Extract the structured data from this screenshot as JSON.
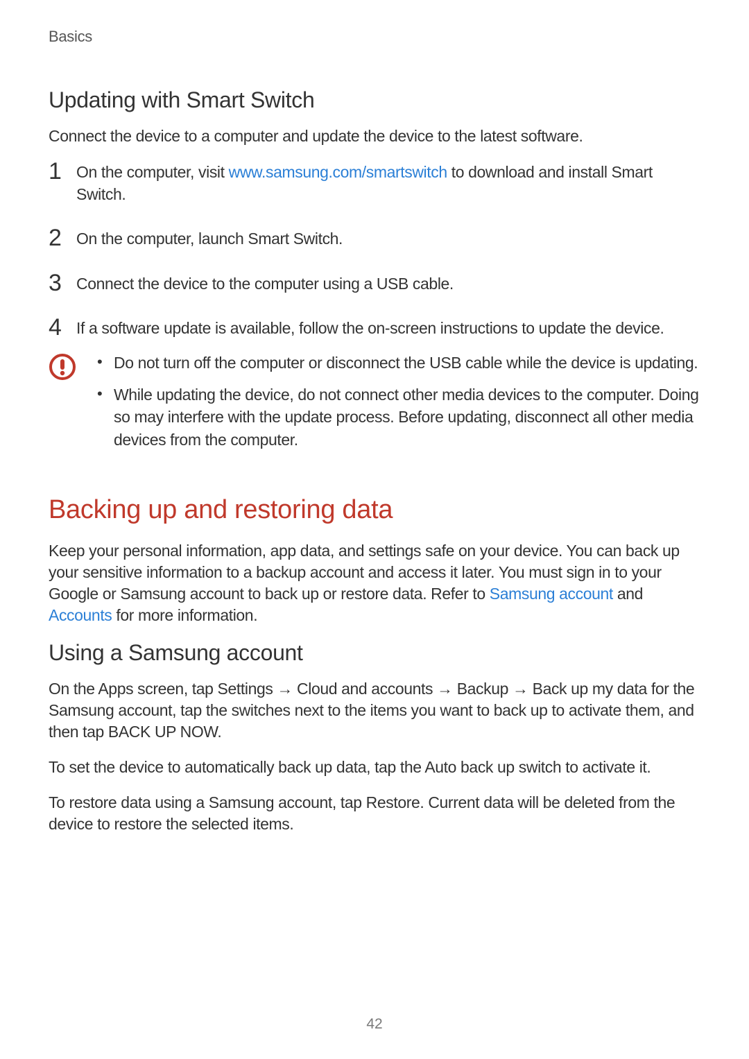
{
  "breadcrumb": "Basics",
  "section1": {
    "heading": "Updating with Smart Switch",
    "intro": "Connect the device to a computer and update the device to the latest software.",
    "steps": {
      "s1_pre": "On the computer, visit ",
      "s1_link": "www.samsung.com/smartswitch",
      "s1_post": " to download and install Smart Switch.",
      "s2": "On the computer, launch Smart Switch.",
      "s3": "Connect the device to the computer using a USB cable.",
      "s4": "If a software update is available, follow the on-screen instructions to update the device."
    },
    "caution": {
      "c1": "Do not turn off the computer or disconnect the USB cable while the device is updating.",
      "c2": "While updating the device, do not connect other media devices to the computer. Doing so may interfere with the update process. Before updating, disconnect all other media devices from the computer."
    }
  },
  "section2": {
    "heading": "Backing up and restoring data",
    "intro_pre": "Keep your personal information, app data, and settings safe on your device. You can back up your sensitive information to a backup account and access it later. You must sign in to your Google or Samsung account to back up or restore data. Refer to ",
    "intro_link1": "Samsung account",
    "intro_mid": " and ",
    "intro_link2": "Accounts",
    "intro_post": " for more information."
  },
  "section3": {
    "heading": "Using a Samsung account",
    "p1": "On the Apps screen, tap Settings → Cloud and accounts → Backup → Back up my data for the Samsung account, tap the switches next to the items you want to back up to activate them, and then tap BACK UP NOW.",
    "p2": "To set the device to automatically back up data, tap the Auto back up switch to activate it.",
    "p3": "To restore data using a Samsung account, tap Restore. Current data will be deleted from the device to restore the selected items."
  },
  "pageNumber": "42"
}
